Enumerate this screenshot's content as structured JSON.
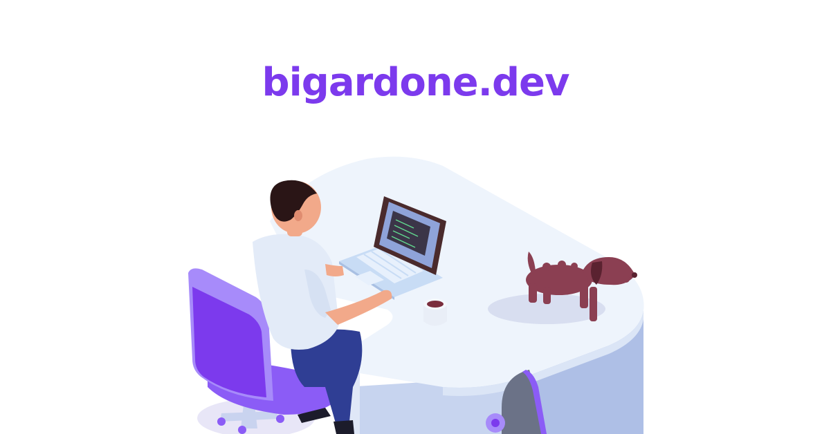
{
  "header": {
    "site_name": "bigardone.dev"
  },
  "colors": {
    "brand": "#7c3aed",
    "desk_top": "#eef4fc",
    "desk_side": "#b7c6ea",
    "chair": "#8b5cf6",
    "dog": "#8b3f52",
    "shirt": "#e3ebf8",
    "pants": "#2f3e94",
    "hair": "#2a1516",
    "skin": "#f2a98a"
  },
  "illustration": {
    "laptop_icon": "laptop-icon",
    "dog_icon": "dog-icon",
    "person_icon": "developer-icon",
    "chair_icon": "office-chair-icon",
    "mug_icon": "coffee-mug-icon"
  }
}
